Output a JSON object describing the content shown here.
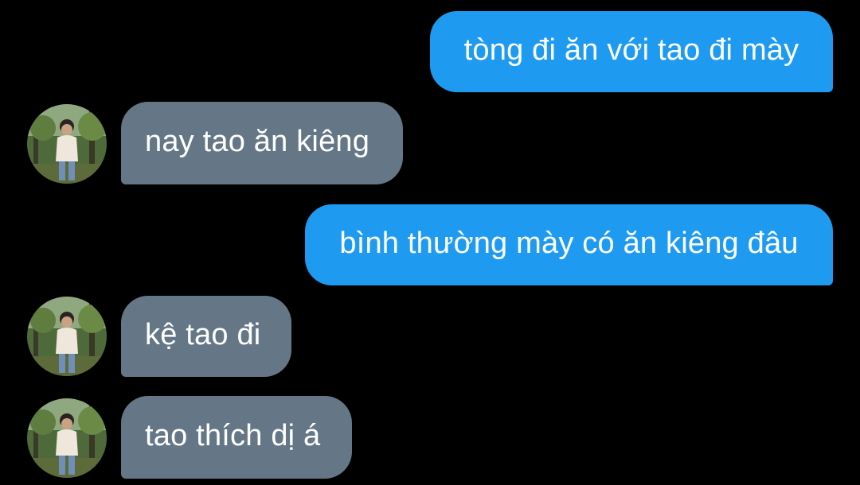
{
  "conversation": {
    "messages": [
      {
        "sender": "me",
        "text": "tòng đi ăn với tao đi mày"
      },
      {
        "sender": "friend",
        "text": "nay tao ăn kiêng"
      },
      {
        "sender": "me",
        "text": "bình thường mày có ăn kiêng đâu"
      },
      {
        "sender": "friend",
        "text": "kệ tao đi"
      },
      {
        "sender": "friend",
        "text": "tao thích dị á"
      }
    ]
  },
  "colors": {
    "background": "#000000",
    "sent_bubble": "#1e9bf0",
    "received_bubble": "#657786",
    "text": "#ffffff"
  },
  "icons": {
    "friend_avatar": "friend-avatar-photo"
  }
}
